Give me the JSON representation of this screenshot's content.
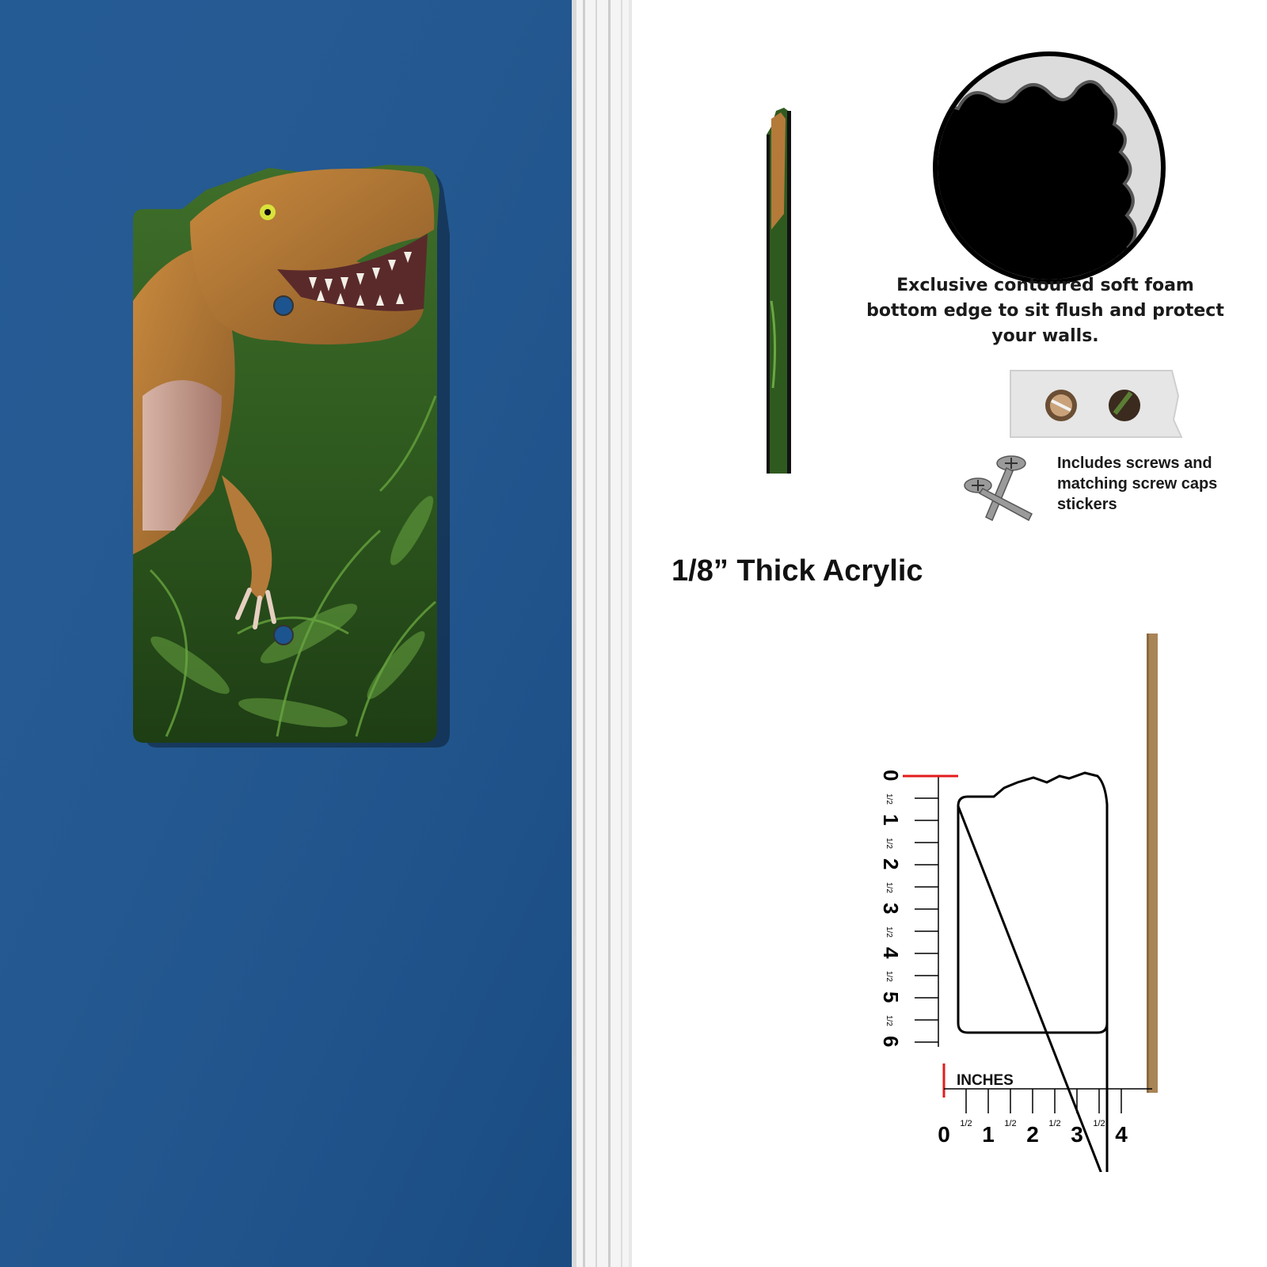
{
  "colors": {
    "wall_blue": "#1c5490",
    "trim_white": "#f2f2f2",
    "ruler_zero_mark": "#e31b1b",
    "wood_strip": "#a98457",
    "foam_gray": "#dcdcdc"
  },
  "front_view": {
    "image": "t-rex-jungle-light-switch-plate",
    "screw_holes": 2
  },
  "side_view": {
    "image": "plate-edge-profile"
  },
  "foam_detail": {
    "image": "foam-edge-closeup-icon",
    "caption": "Exclusive contoured soft foam bottom edge to sit flush and protect your walls."
  },
  "screws_info": {
    "caps_image": "screw-cap-stickers-icon",
    "screws_image": "screws-icon",
    "caption": "Includes screws and matching screw caps stickers"
  },
  "thickness_label": "1/8” Thick Acrylic",
  "dimension_diagram": {
    "units_label": "INCHES",
    "vertical_ruler": {
      "major_labels": [
        "0",
        "1",
        "2",
        "3",
        "4",
        "5",
        "6"
      ],
      "half_label": "1/2"
    },
    "horizontal_ruler": {
      "major_labels": [
        "0",
        "1",
        "2",
        "3",
        "4"
      ],
      "half_label": "1/2"
    }
  }
}
